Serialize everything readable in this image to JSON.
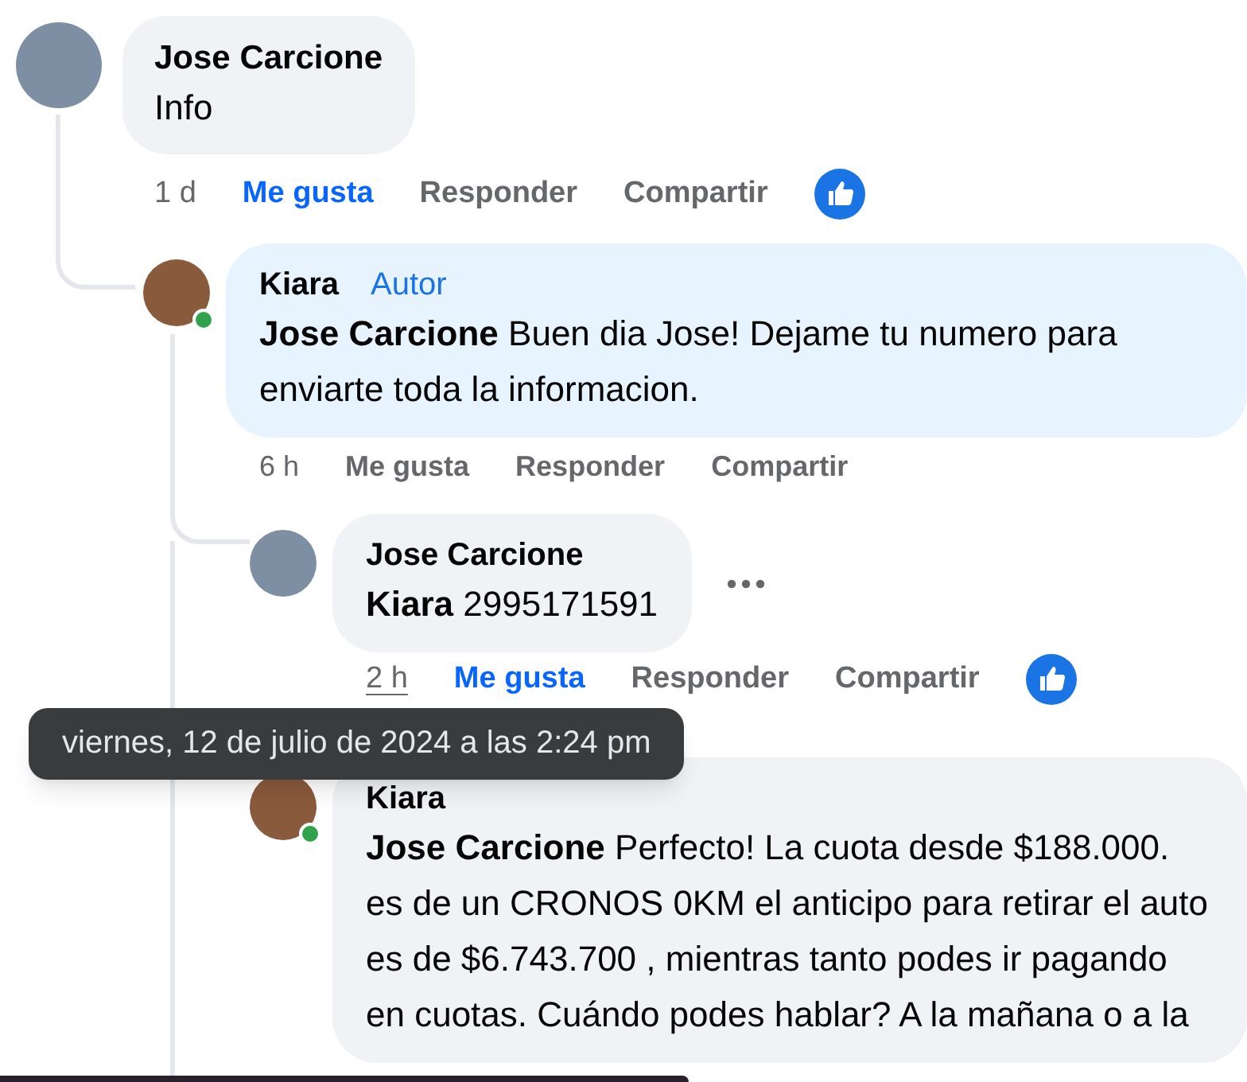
{
  "comments": [
    {
      "author": "Jose Carcione",
      "color": "#7f8fa3",
      "text": "Info",
      "time": "1 d",
      "time_hovered": false,
      "liked": true,
      "actions": [
        "Me gusta",
        "Responder",
        "Compartir"
      ],
      "like_reaction": true,
      "online": false,
      "children": [
        {
          "author": "Kiara",
          "color": "#8a5a3c",
          "badge": "Autor",
          "mention": "Jose Carcione",
          "text": "Buen dia Jose! Dejame tu numero para enviarte toda la informacion.",
          "time": "6 h",
          "time_hovered": false,
          "liked": false,
          "actions": [
            "Me gusta",
            "Responder",
            "Compartir"
          ],
          "online": true,
          "children": [
            {
              "author": "Jose Carcione",
              "color": "#7f8fa3",
              "mention": "Kiara",
              "text": "2995171591",
              "time": "2 h",
              "time_hovered": true,
              "liked": true,
              "actions": [
                "Me gusta",
                "Responder",
                "Compartir"
              ],
              "like_reaction": true,
              "online": false,
              "more_button": true
            },
            {
              "author": "Kiara",
              "color": "#8a5a3c",
              "mention": "Jose Carcione",
              "text": "Perfecto! La cuota desde $188.000. es de un CRONOS 0KM el anticipo para retirar el auto es de $6.743.700 , mientras tanto podes ir pagando en cuotas. Cuándo podes hablar? A la mañana o a la",
              "online": true
            }
          ]
        }
      ]
    }
  ],
  "tooltip": {
    "text": "viernes, 12 de julio de 2024 a las 2:24 pm"
  }
}
